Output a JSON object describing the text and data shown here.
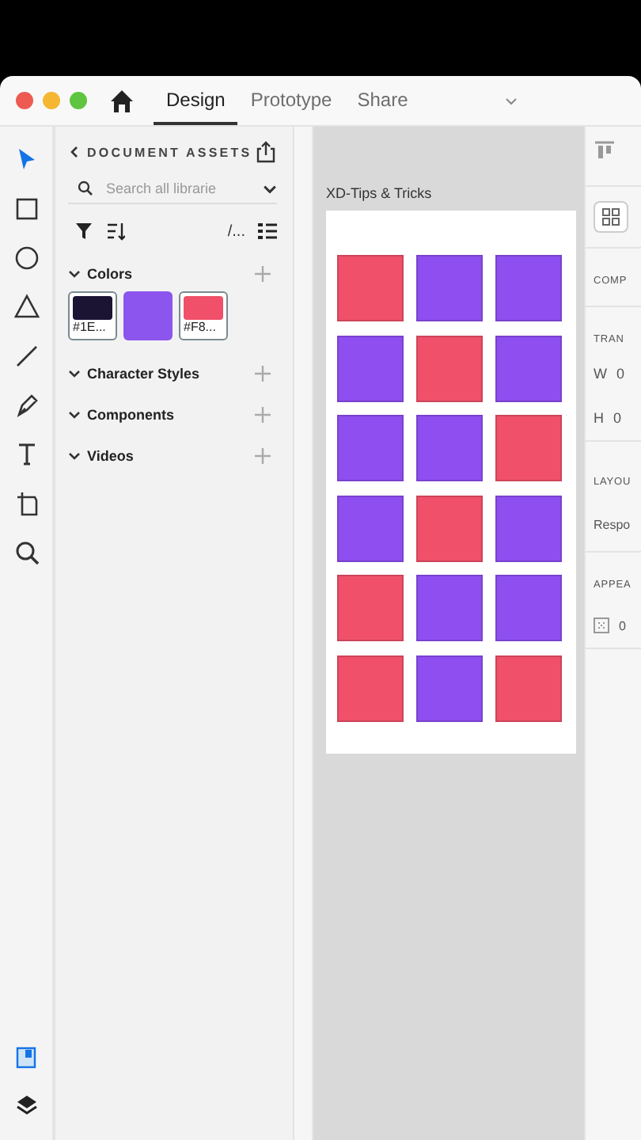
{
  "window_controls": [
    {
      "color": "#ee5a52"
    },
    {
      "color": "#f5b731"
    },
    {
      "color": "#5fc43f"
    }
  ],
  "tabs": [
    {
      "label": "Design",
      "selected": true
    },
    {
      "label": "Prototype",
      "selected": false
    },
    {
      "label": "Share",
      "selected": false
    }
  ],
  "tools": [
    {
      "kind": "select",
      "selected": true
    },
    {
      "kind": "rectangle",
      "selected": false
    },
    {
      "kind": "ellipse",
      "selected": false
    },
    {
      "kind": "polygon",
      "selected": false
    },
    {
      "kind": "line",
      "selected": false
    },
    {
      "kind": "pen",
      "selected": false
    },
    {
      "kind": "text",
      "selected": false
    },
    {
      "kind": "artboard",
      "selected": false
    },
    {
      "kind": "zoom",
      "selected": false
    }
  ],
  "assets": {
    "title": "DOCUMENT ASSETS",
    "search": {
      "placeholder": "Search all librarie"
    },
    "path_toggle": "/...",
    "sections": [
      {
        "title": "Colors",
        "swatches": [
          {
            "label": "#1E...",
            "color": "#1b1433"
          },
          {
            "color": "#8b55ee"
          },
          {
            "label": "#F8...",
            "color": "#f0506a"
          }
        ]
      },
      {
        "title": "Character Styles"
      },
      {
        "title": "Components"
      },
      {
        "title": "Videos"
      }
    ]
  },
  "canvas": {
    "artboard_title": "XD-Tips & Tricks",
    "squares": [
      {
        "color": "#f0506a"
      },
      {
        "color": "#8e4ef0"
      },
      {
        "color": "#8e4ef0"
      },
      {
        "color": "#8e4ef0"
      },
      {
        "color": "#f0506a"
      },
      {
        "color": "#8e4ef0"
      },
      {
        "color": "#8e4ef0"
      },
      {
        "color": "#8e4ef0"
      },
      {
        "color": "#f0506a"
      },
      {
        "color": "#8e4ef0"
      },
      {
        "color": "#f0506a"
      },
      {
        "color": "#8e4ef0"
      },
      {
        "color": "#f0506a"
      },
      {
        "color": "#8e4ef0"
      },
      {
        "color": "#8e4ef0"
      },
      {
        "color": "#f0506a"
      },
      {
        "color": "#8e4ef0"
      },
      {
        "color": "#f0506a"
      }
    ]
  },
  "inspector": {
    "component_label": "COMP",
    "transform_label": "TRAN",
    "width": {
      "label": "W",
      "value": "0"
    },
    "height": {
      "label": "H",
      "value": "0"
    },
    "layout_label": "LAYOU",
    "layout_value": "Respo",
    "appearance_label": "APPEA",
    "opacity_value": "0"
  }
}
